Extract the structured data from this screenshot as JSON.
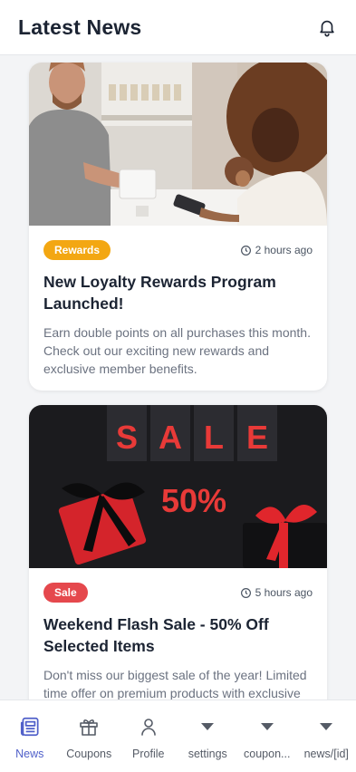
{
  "header": {
    "title": "Latest News"
  },
  "articles": [
    {
      "badge": "Rewards",
      "badge_color": "#f3a712",
      "time": "2 hours ago",
      "title": "New Loyalty Rewards Program Launched!",
      "description": "Earn double points on all purchases this month. Check out our exciting new rewards and exclusive member benefits."
    },
    {
      "badge": "Sale",
      "badge_color": "#e5484d",
      "time": "5 hours ago",
      "title": "Weekend Flash Sale - 50% Off Selected Items",
      "description": "Don't miss our biggest sale of the year! Limited time offer on premium products with exclusive",
      "image_text": {
        "sale": [
          "S",
          "A",
          "L",
          "E"
        ],
        "percent": "50%"
      }
    }
  ],
  "tabs": [
    {
      "label": "News",
      "icon": "newspaper-icon",
      "active": true
    },
    {
      "label": "Coupons",
      "icon": "gift-icon"
    },
    {
      "label": "Profile",
      "icon": "person-icon"
    },
    {
      "label": "settings",
      "icon": "caret-down-icon"
    },
    {
      "label": "coupon...",
      "icon": "caret-down-icon"
    },
    {
      "label": "news/[id]",
      "icon": "caret-down-icon"
    }
  ],
  "colors": {
    "accent": "#4f5fc9",
    "rewards": "#f3a712",
    "sale": "#e5484d"
  }
}
